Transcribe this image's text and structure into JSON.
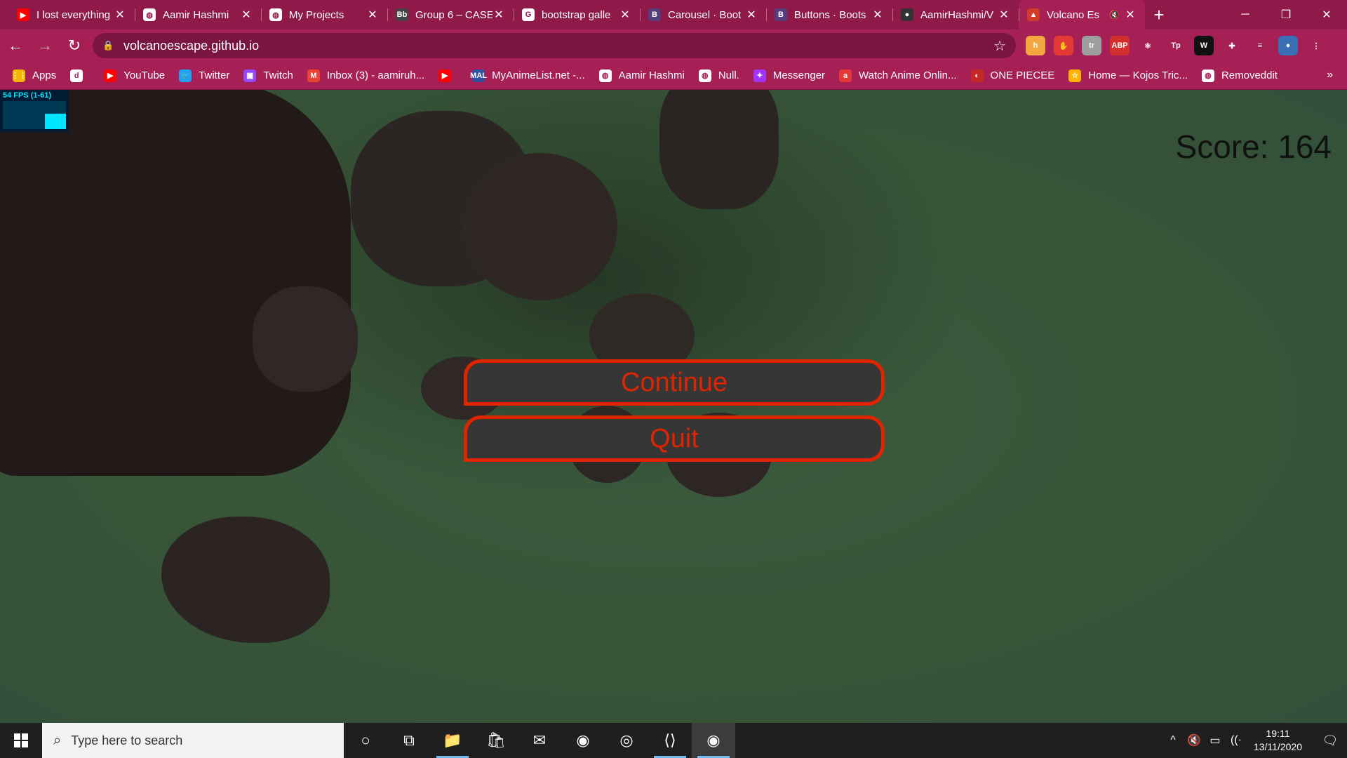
{
  "browser": {
    "tabs": [
      {
        "title": "I lost everything",
        "icon": "youtube-icon",
        "color": "#ff0000",
        "glyph": "▶"
      },
      {
        "title": "Aamir Hashmi",
        "icon": "globe-icon",
        "color": "#ffffff",
        "glyph": "◍"
      },
      {
        "title": "My Projects",
        "icon": "globe-icon",
        "color": "#ffffff",
        "glyph": "◍"
      },
      {
        "title": "Group 6 – CASE",
        "icon": "blackboard-icon",
        "color": "#444444",
        "glyph": "Bb"
      },
      {
        "title": "bootstrap galle",
        "icon": "google-icon",
        "color": "#ffffff",
        "glyph": "G"
      },
      {
        "title": "Carousel · Boot",
        "icon": "bootstrap-icon",
        "color": "#563d7c",
        "glyph": "B"
      },
      {
        "title": "Buttons · Boots",
        "icon": "bootstrap-icon",
        "color": "#563d7c",
        "glyph": "B"
      },
      {
        "title": "AamirHashmi/V",
        "icon": "github-icon",
        "color": "#333333",
        "glyph": "●"
      },
      {
        "title": "Volcano Es",
        "icon": "volcano-icon",
        "color": "#d13b2a",
        "glyph": "▲",
        "active": true,
        "muted": "🔇"
      }
    ],
    "new_tab": "+",
    "window_controls": {
      "minimize": "─",
      "restore": "❐",
      "close": "✕"
    },
    "url": "volcanoescape.github.io",
    "extensions": [
      {
        "name": "honey-extension-icon",
        "color": "#f4a640",
        "glyph": "h"
      },
      {
        "name": "stop-extension-icon",
        "color": "#e53935",
        "glyph": "✋"
      },
      {
        "name": "translate-extension-icon",
        "color": "#9e9e9e",
        "glyph": "tr"
      },
      {
        "name": "adblock-extension-icon",
        "color": "#d32f2f",
        "glyph": "ABP"
      },
      {
        "name": "react-devtools-icon",
        "color": "#a61f55",
        "glyph": "⚛"
      },
      {
        "name": "tp-extension-icon",
        "color": "#a61f55",
        "glyph": "Tp"
      },
      {
        "name": "w-extension-icon",
        "color": "#111111",
        "glyph": "W"
      },
      {
        "name": "puzzle-extensions-icon",
        "color": "#a61f55",
        "glyph": "✚"
      },
      {
        "name": "media-control-icon",
        "color": "#a61f55",
        "glyph": "≡"
      },
      {
        "name": "profile-avatar-icon",
        "color": "#3b6fb5",
        "glyph": "●"
      },
      {
        "name": "menu-icon",
        "color": "#a61f55",
        "glyph": "⋮"
      }
    ],
    "bookmarks": [
      {
        "label": "Apps",
        "icon": "apps-grid-icon",
        "color": "#f4b400",
        "glyph": "⋮⋮"
      },
      {
        "label": "",
        "icon": "d-icon",
        "color": "#ffffff",
        "glyph": "d"
      },
      {
        "label": "YouTube",
        "icon": "youtube-icon",
        "color": "#ff0000",
        "glyph": "▶"
      },
      {
        "label": "Twitter",
        "icon": "twitter-icon",
        "color": "#1da1f2",
        "glyph": "🐦"
      },
      {
        "label": "Twitch",
        "icon": "twitch-icon",
        "color": "#9146ff",
        "glyph": "▣"
      },
      {
        "label": "Inbox (3) - aamiruh...",
        "icon": "gmail-icon",
        "color": "#ea4335",
        "glyph": "M"
      },
      {
        "label": "",
        "icon": "youtube-icon",
        "color": "#ff0000",
        "glyph": "▶"
      },
      {
        "label": "MyAnimeList.net -...",
        "icon": "myanimelist-icon",
        "color": "#2e51a2",
        "glyph": "MAL"
      },
      {
        "label": "Aamir Hashmi",
        "icon": "globe-icon",
        "color": "#ffffff",
        "glyph": "◍"
      },
      {
        "label": "Null.",
        "icon": "globe-icon",
        "color": "#ffffff",
        "glyph": "◍"
      },
      {
        "label": "Messenger",
        "icon": "messenger-icon",
        "color": "#a033ff",
        "glyph": "✦"
      },
      {
        "label": "Watch Anime Onlin...",
        "icon": "anime-site-icon",
        "color": "#e53935",
        "glyph": "a"
      },
      {
        "label": "ONE PIECEE",
        "icon": "onepiece-icon",
        "color": "#c62828",
        "glyph": "◐"
      },
      {
        "label": "Home — Kojos Tric...",
        "icon": "kojo-icon",
        "color": "#ffb300",
        "glyph": "☆"
      },
      {
        "label": "Removeddit",
        "icon": "globe-icon",
        "color": "#ffffff",
        "glyph": "◍"
      }
    ],
    "bookmarks_more": "»"
  },
  "game": {
    "fps_label": "54 FPS (1-61)",
    "score_text": "Score: 164",
    "menu": {
      "continue_label": "Continue",
      "quit_label": "Quit"
    },
    "accent_color": "#e02400"
  },
  "taskbar": {
    "search_placeholder": "Type here to search",
    "apps": [
      {
        "name": "cortana-icon",
        "glyph": "○"
      },
      {
        "name": "task-view-icon",
        "glyph": "⧉"
      },
      {
        "name": "file-explorer-icon",
        "glyph": "📁",
        "running": true
      },
      {
        "name": "microsoft-store-icon",
        "glyph": "🛍"
      },
      {
        "name": "mail-icon",
        "glyph": "✉"
      },
      {
        "name": "chrome-icon",
        "glyph": "◉"
      },
      {
        "name": "github-desktop-icon",
        "glyph": "◎"
      },
      {
        "name": "vscode-icon",
        "glyph": "⟨⟩",
        "running": true
      },
      {
        "name": "chrome-active-icon",
        "glyph": "◉",
        "running": true,
        "active": true
      }
    ],
    "tray_icons": [
      "^",
      "🔇",
      "▭",
      "((·"
    ],
    "time": "19:11",
    "date": "13/11/2020",
    "notification": "🗨"
  }
}
